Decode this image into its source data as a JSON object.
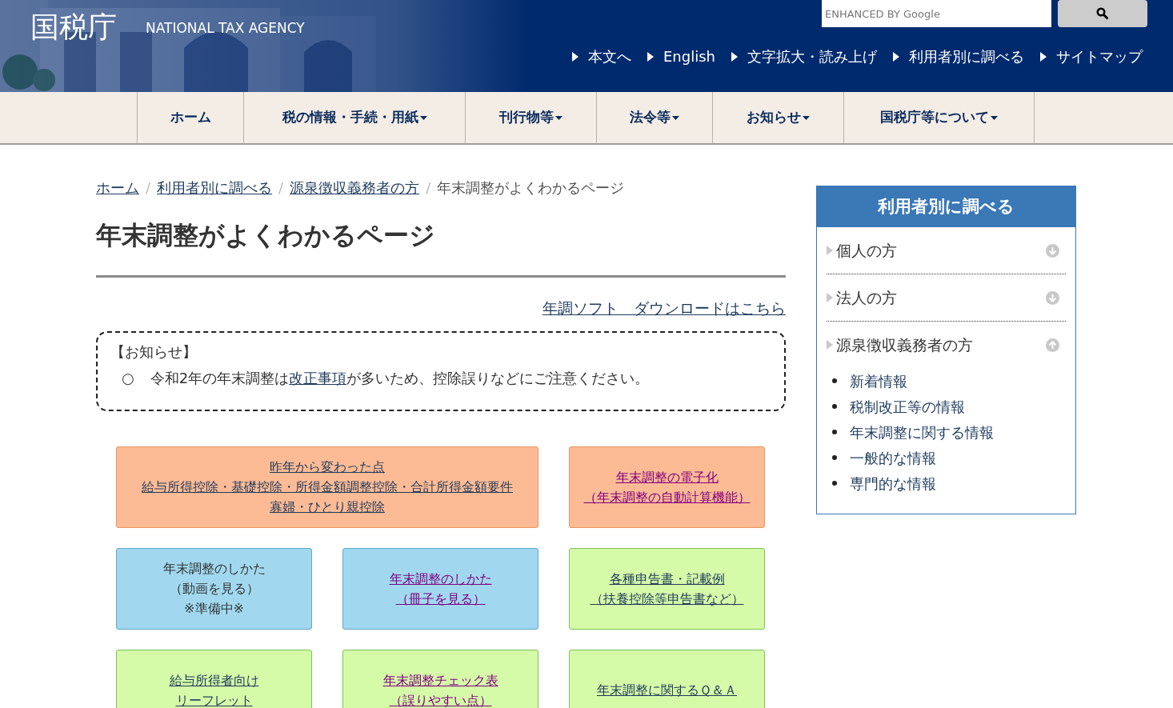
{
  "header": {
    "logo": "国税庁",
    "logo_en": "NATIONAL TAX AGENCY",
    "search": {
      "placeholder": "ENHANCED BY Google"
    },
    "links": [
      "本文へ",
      "English",
      "文字拡大・読み上げ",
      "利用者別に調べる",
      "サイトマップ"
    ]
  },
  "nav": [
    {
      "label": "ホーム",
      "dropdown": false
    },
    {
      "label": "税の情報・手続・用紙",
      "dropdown": true
    },
    {
      "label": "刊行物等",
      "dropdown": true
    },
    {
      "label": "法令等",
      "dropdown": true
    },
    {
      "label": "お知らせ",
      "dropdown": true
    },
    {
      "label": "国税庁等について",
      "dropdown": true
    }
  ],
  "breadcrumb": [
    {
      "label": "ホーム",
      "link": true,
      "separator": "/"
    },
    {
      "label": "利用者別に調べる",
      "link": true,
      "separator": "/"
    },
    {
      "label": "源泉徴収義務者の方",
      "link": true,
      "separator": "/"
    },
    {
      "label": "年末調整がよくわかるページ",
      "link": false
    }
  ],
  "title": "年末調整がよくわかるページ",
  "download_link": "年調ソフト　ダウンロードはこちら",
  "notice": {
    "heading": "【お知らせ】",
    "bullet": "○",
    "before": "令和2年の年末調整は",
    "link": "改正事項",
    "after": "が多いため、控除誤りなどにご注意ください。"
  },
  "tiles": [
    {
      "color": "#fcbb94",
      "kind": "link",
      "visited": false,
      "wide": true,
      "lines": [
        "昨年から変わった点",
        "給与所得控除・基礎控除・所得金額調整控除・合計所得金額要件",
        "寡婦・ひとり親控除"
      ]
    },
    {
      "color": "#fcbb94",
      "kind": "link",
      "visited": true,
      "wide": false,
      "lines": [
        "年末調整の電子化",
        "（年末調整の自動計算機能）"
      ]
    },
    {
      "color": "#a1d8ef",
      "kind": "text",
      "wide": false,
      "lines": [
        "年末調整のしかた",
        "（動画を見る）",
        "※準備中※"
      ]
    },
    {
      "color": "#a1d8ef",
      "kind": "link",
      "visited": true,
      "wide": false,
      "lines": [
        "年末調整のしかた",
        "（冊子を見る）"
      ]
    },
    {
      "color": "#d5fba8",
      "kind": "link",
      "visited": false,
      "wide": false,
      "lines": [
        "各種申告書・記載例",
        "（扶養控除等申告書など）"
      ]
    },
    {
      "color": "#d5fba8",
      "kind": "link",
      "visited": false,
      "wide": false,
      "lines": [
        "給与所得者向け",
        "リーフレット"
      ]
    },
    {
      "color": "#d5fba8",
      "kind": "link",
      "visited": true,
      "wide": false,
      "lines": [
        "年末調整チェック表",
        "（誤りやすい点）"
      ]
    },
    {
      "color": "#d5fba8",
      "kind": "link",
      "visited": false,
      "wide": false,
      "lines": [
        "年末調整に関するＱ＆Ａ"
      ]
    }
  ],
  "sidebar": {
    "title": "利用者別に調べる",
    "items": [
      {
        "label": "個人の方",
        "expanded": false
      },
      {
        "label": "法人の方",
        "expanded": false
      },
      {
        "label": "源泉徴収義務者の方",
        "expanded": true,
        "children": [
          "新着情報",
          "税制改正等の情報",
          "年末調整に関する情報",
          "一般的な情報",
          "専門的な情報"
        ]
      }
    ]
  }
}
